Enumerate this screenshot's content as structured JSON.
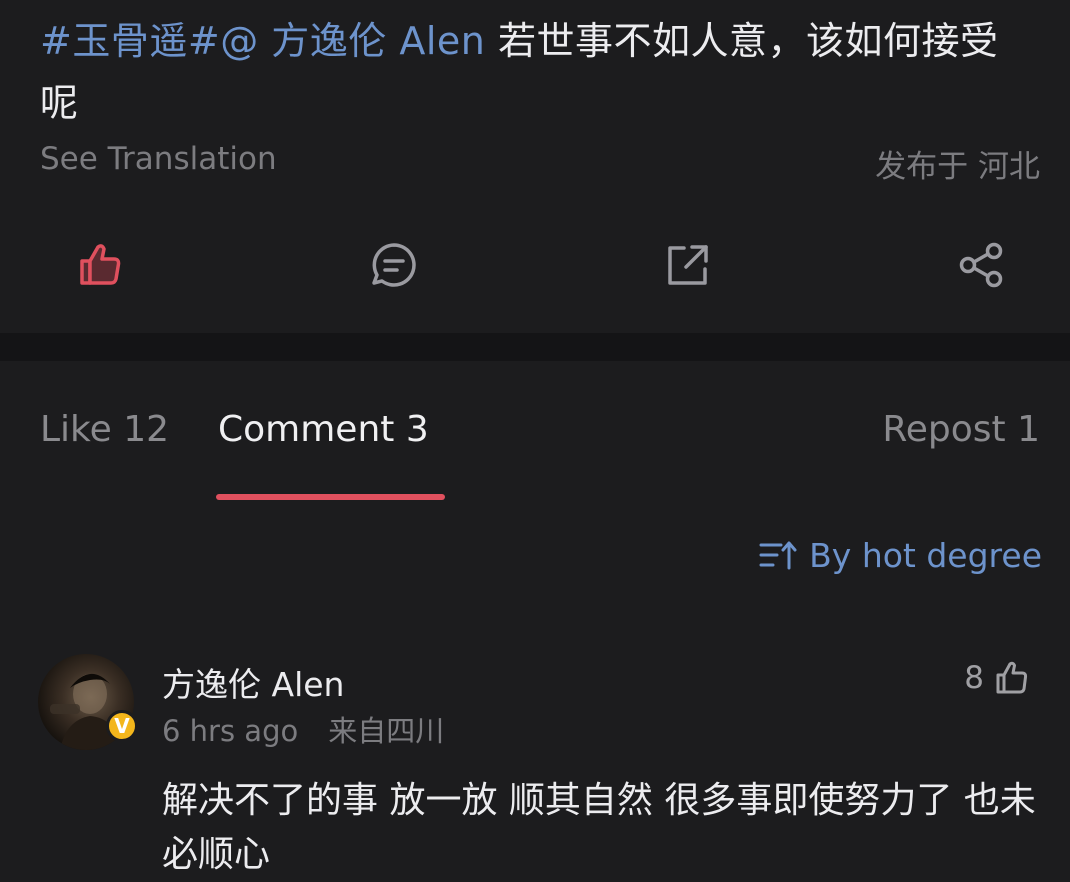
{
  "post": {
    "topic": "#玉骨遥#",
    "mention": "@ 方逸伦 Alen",
    "body_text": " 若世事不如人意，该如何接受呢",
    "see_translation": "See Translation",
    "location": "发布于 河北"
  },
  "actions": {
    "like_icon": "thumbs-up-icon",
    "comment_icon": "comment-icon",
    "repost_icon": "repost-icon",
    "share_icon": "share-icon",
    "like_color": "#e0505e"
  },
  "tabs": {
    "like": "Like 12",
    "comment": "Comment 3",
    "repost": "Repost 1",
    "active": "comment"
  },
  "sort": {
    "label": "By hot degree",
    "icon": "sort-icon"
  },
  "comments": [
    {
      "name": "方逸伦 Alen",
      "time": "6 hrs ago",
      "location": "来自四川",
      "likes": "8",
      "verified": "V",
      "text": "解决不了的事 放一放 顺其自然 很多事即使努力了 也未必顺心"
    }
  ],
  "colors": {
    "background": "#1c1c1e",
    "link": "#6d93cc",
    "accent": "#e0505e",
    "muted": "#7c7c80",
    "verified": "#f3b61c"
  }
}
